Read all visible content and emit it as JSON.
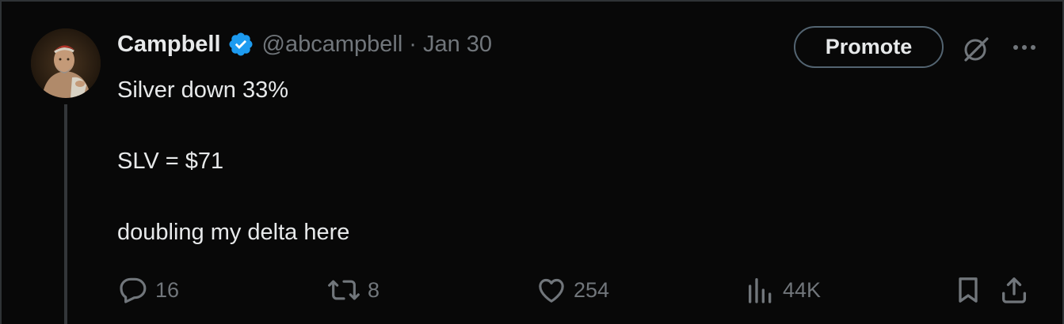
{
  "tweet": {
    "author": {
      "display_name": "Campbell",
      "handle": "@abcampbell",
      "verified": true,
      "avatar": "classical-painting-portrait"
    },
    "separator": "·",
    "date": "Jan 30",
    "lines": [
      "Silver down 33%",
      "SLV = $71",
      "doubling my delta here"
    ],
    "promote_label": "Promote",
    "stats": {
      "replies": "16",
      "reposts": "8",
      "likes": "254",
      "views": "44K"
    },
    "icons": {
      "verified": "verified-badge-icon",
      "grok": "grok-icon",
      "more": "more-horizontal-icon",
      "reply": "reply-icon",
      "repost": "repost-icon",
      "like": "heart-icon",
      "views": "views-chart-icon",
      "bookmark": "bookmark-icon",
      "share": "share-icon"
    }
  },
  "colors": {
    "background": "#080808",
    "text_primary": "#e7e9ea",
    "text_secondary": "#71767b",
    "verified_blue": "#1d9bf0",
    "border": "#2f3336"
  }
}
